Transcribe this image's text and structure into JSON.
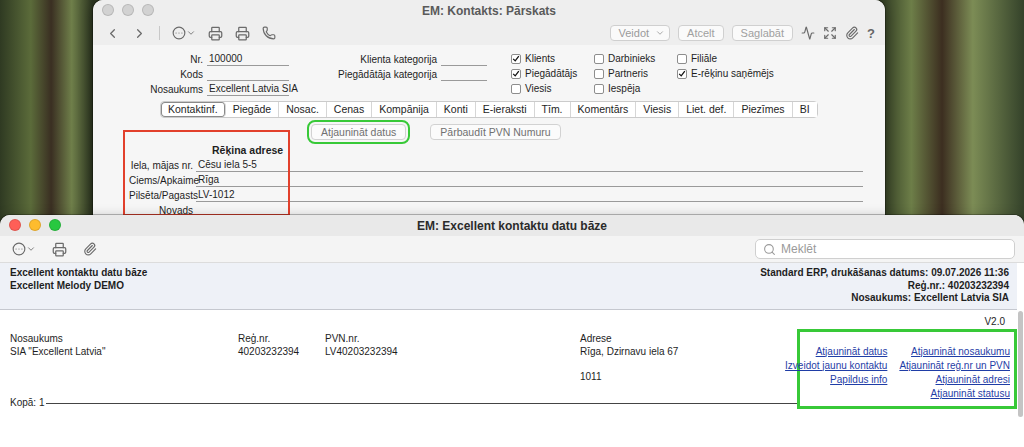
{
  "annotation_colors": {
    "red": "#e2402c",
    "green": "#38c938"
  },
  "detail_window": {
    "title": "EM: Kontakts: Pārskats",
    "toolbar": {
      "create_menu": "Veidot",
      "buttons": [
        {
          "label": "Atcelt",
          "disabled": true
        },
        {
          "label": "Saglabāt",
          "disabled": true
        }
      ],
      "help": "?"
    },
    "fields_left": [
      {
        "label": "Nr.",
        "value": "100000"
      },
      {
        "label": "Kods",
        "value": ""
      },
      {
        "label": "Nosaukums",
        "value": "Excellent Latvia SIA"
      }
    ],
    "fields_middle": [
      {
        "label": "Klienta kategorija",
        "value": ""
      },
      {
        "label": "Piegādātāja kategorija",
        "value": ""
      }
    ],
    "checkboxes": [
      {
        "label": "Klients",
        "checked": true
      },
      {
        "label": "Piegādātājs",
        "checked": true
      },
      {
        "label": "Viesis",
        "checked": false
      },
      {
        "label": "Darbinieks",
        "checked": false
      },
      {
        "label": "Partneris",
        "checked": false
      },
      {
        "label": "Iespēja",
        "checked": false
      },
      {
        "label": "Filiāle",
        "checked": false
      },
      {
        "label": "E-rēķinu saņēmējs",
        "checked": true
      }
    ],
    "tabs": [
      {
        "label": "Kontaktinf.",
        "selected": true
      },
      {
        "label": "Piegāde",
        "selected": false
      },
      {
        "label": "Nosac.",
        "selected": false
      },
      {
        "label": "Cenas",
        "selected": false
      },
      {
        "label": "Kompānija",
        "selected": false
      },
      {
        "label": "Konti",
        "selected": false
      },
      {
        "label": "E-ieraksti",
        "selected": false
      },
      {
        "label": "Tīm.",
        "selected": false
      },
      {
        "label": "Komentārs",
        "selected": false
      },
      {
        "label": "Viesis",
        "selected": false
      },
      {
        "label": "Liet. def.",
        "selected": false
      },
      {
        "label": "Piezīmes",
        "selected": false
      },
      {
        "label": "BI",
        "selected": false
      }
    ],
    "actions": [
      {
        "label": "Atjaunināt datus",
        "annotated": true
      },
      {
        "label": "Pārbaudīt PVN Numuru",
        "annotated": false
      }
    ],
    "address": {
      "heading": "Rēķina adrese",
      "annotated": true,
      "fields": [
        {
          "label": "Iela, mājas nr.",
          "value": "Cēsu iela 5-5"
        },
        {
          "label": "Ciems/Apkaime",
          "value": "Rīga"
        },
        {
          "label": "Pilsēta/Pagasts",
          "value": "LV-1012"
        },
        {
          "label": "Novads",
          "value": ""
        }
      ]
    }
  },
  "report_window": {
    "title": "EM: Excellent kontaktu datu bāze",
    "search": {
      "placeholder": "Meklēt"
    },
    "header_left": [
      "Excellent kontaktu datu bāze",
      "Excellent Melody DEMO"
    ],
    "header_right": [
      "Standard ERP, drukāšanas datums: 09.07.2026 11:36",
      "Reģ.nr.: 40203232394",
      "Nosaukums: Excellent Latvia SIA"
    ],
    "version": "V2.0",
    "table": {
      "columns": [
        "Nosaukums",
        "Reģ.nr.",
        "PVN.nr.",
        "Adrese"
      ],
      "rows": [
        {
          "cells": [
            "SIA \"Excellent Latvia\"",
            "40203232394",
            "LV40203232394",
            "Rīga, Dzirnavu iela 67"
          ],
          "extra": "1011"
        }
      ]
    },
    "links": {
      "annotated": true,
      "rows": [
        [
          "Atjaunināt datus",
          "Atjaunināt nosaukumu"
        ],
        [
          "Izveidot jaunu kontaktu",
          "Atjaunināt reģ.nr un PVN"
        ],
        [
          "Papildus info",
          "Atjaunināt adresi"
        ],
        [
          "",
          "Atjaunināt statusu"
        ]
      ]
    },
    "total": "Kopā: 1"
  }
}
